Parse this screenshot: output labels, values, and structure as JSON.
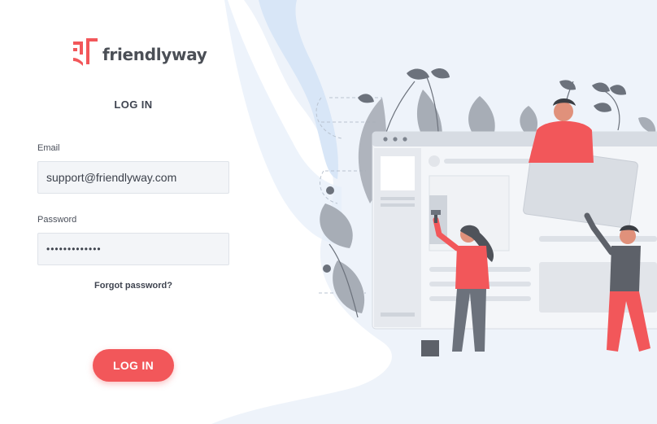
{
  "brand": {
    "name": "friendlyway",
    "accent_color": "#f2575a",
    "logo_icon": "friendlyway-logo-icon"
  },
  "login": {
    "title": "LOG IN",
    "email_label": "Email",
    "email_value": "support@friendlyway.com",
    "password_label": "Password",
    "password_value": "•••••••••••••",
    "forgot_label": "Forgot password?",
    "submit_label": "LOG IN"
  },
  "illustration": {
    "name": "people-building-website-illustration",
    "colors": {
      "leaf": "#a7adb6",
      "shirt": "#f2575a",
      "pants_dark": "#5d6169",
      "browser": "#e9ecf1"
    }
  }
}
